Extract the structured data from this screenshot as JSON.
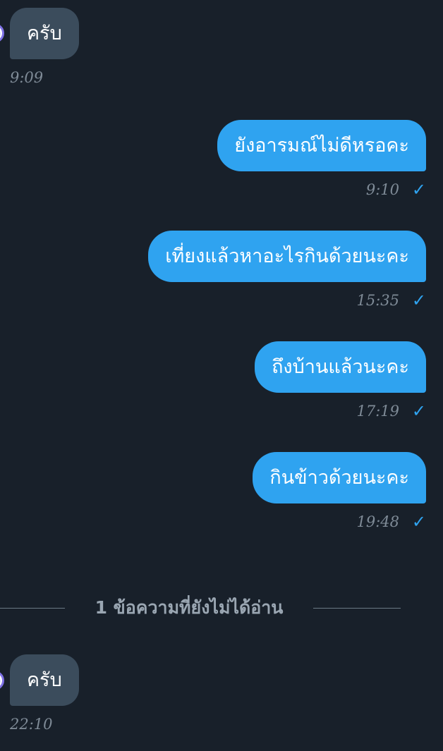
{
  "messages": {
    "m1": {
      "text": "ครับ",
      "time": "9:09"
    },
    "m2": {
      "text": "ยังอารมณ์ไม่ดีหรอคะ",
      "time": "9:10"
    },
    "m3": {
      "text": "เที่ยงแล้วหาอะไรกินด้วยนะคะ",
      "time": "15:35"
    },
    "m4": {
      "text": "ถึงบ้านแล้วนะคะ",
      "time": "17:19"
    },
    "m5": {
      "text": "กินข้าวด้วยนะคะ",
      "time": "19:48"
    },
    "m6": {
      "text": "ครับ",
      "time": "22:10"
    }
  },
  "unread_divider": {
    "text": "1 ข้อความที่ยังไม่ได้อ่าน"
  },
  "read_check": "✓",
  "colors": {
    "background": "#18202a",
    "incoming_bubble": "#3b4c5c",
    "outgoing_bubble": "#2fa3f0",
    "check": "#2fa3f0"
  }
}
